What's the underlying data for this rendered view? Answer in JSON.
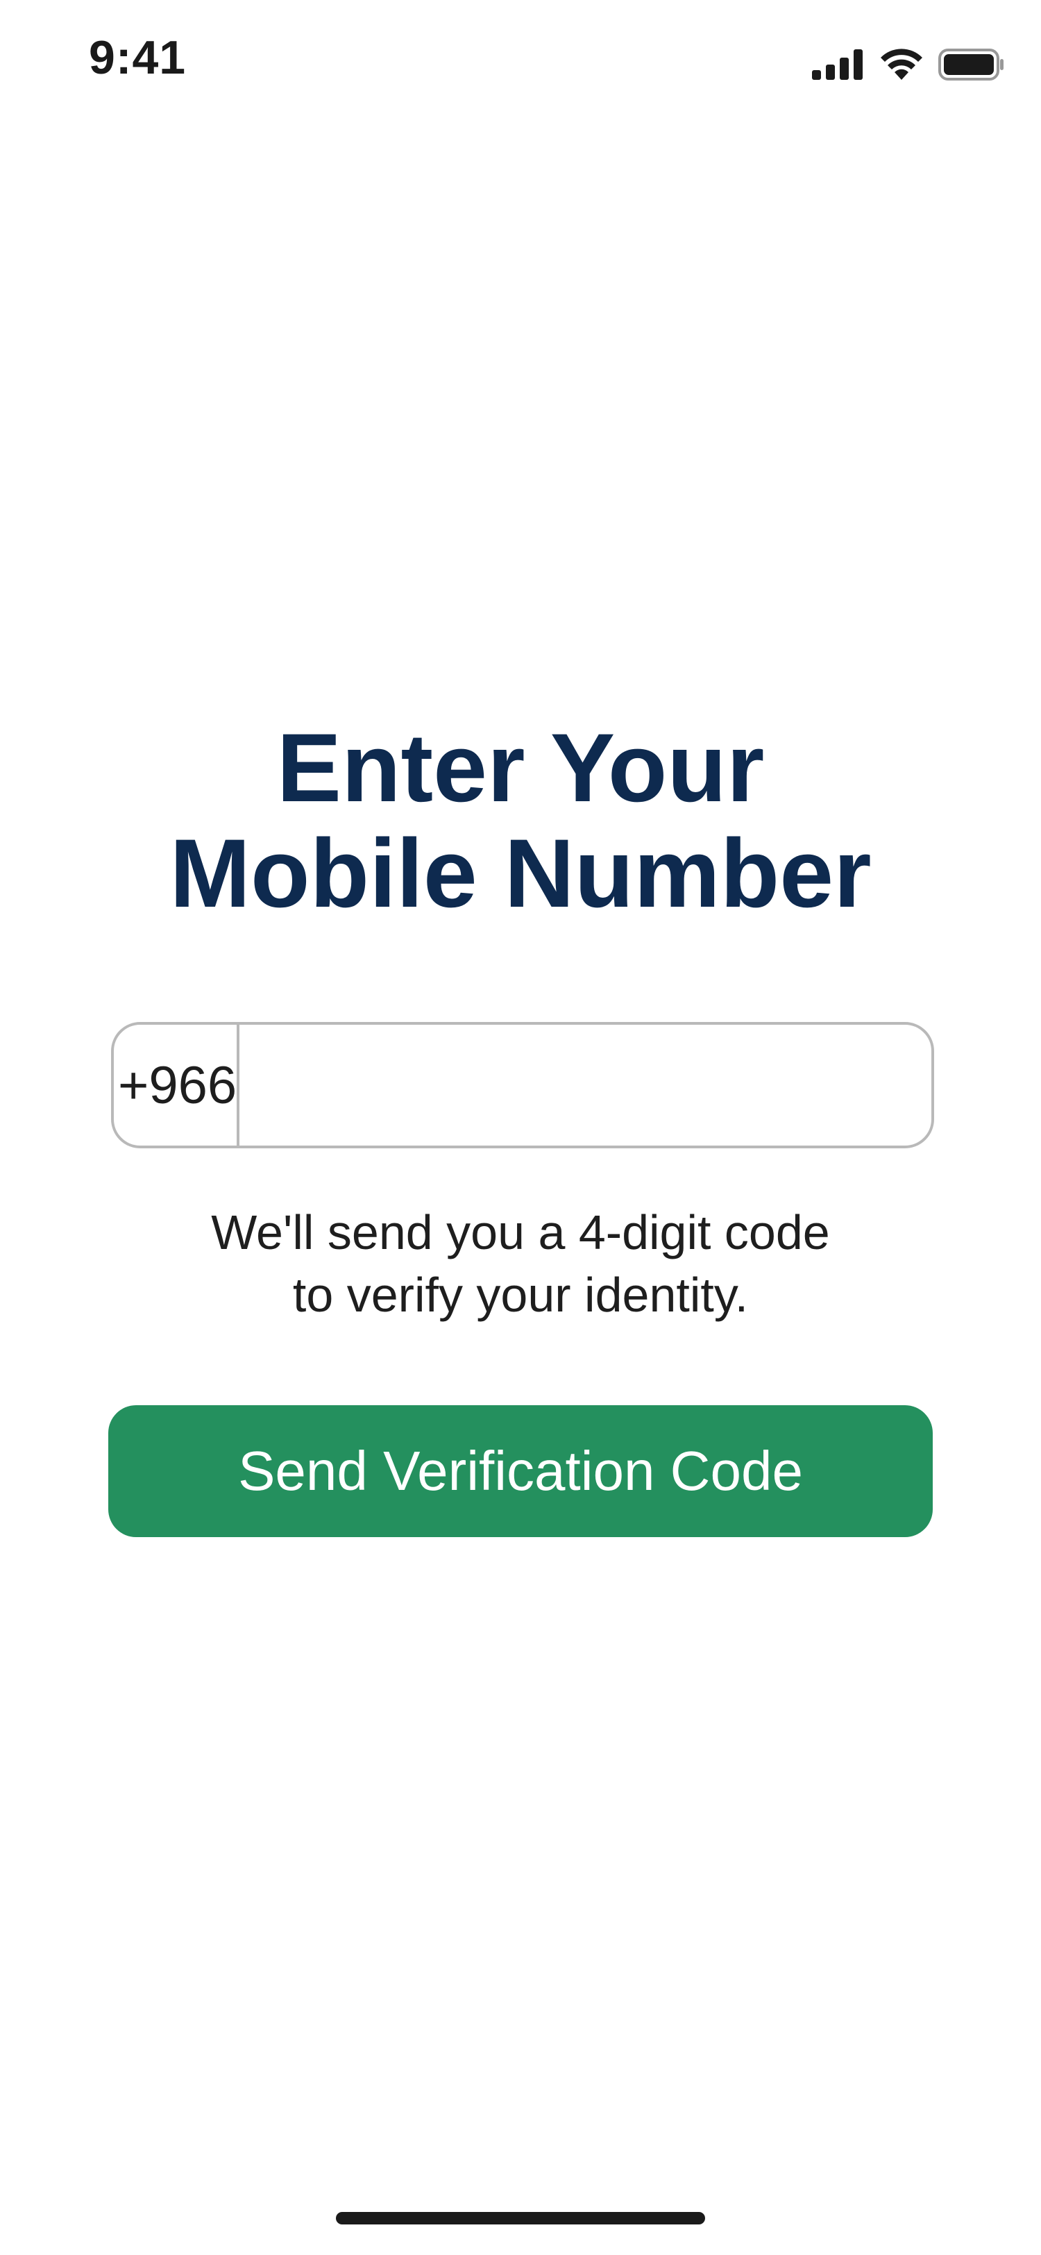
{
  "status_bar": {
    "time": "9:41",
    "icons": [
      "signal-icon",
      "wifi-icon",
      "battery-icon"
    ]
  },
  "screen": {
    "title_line_1": "Enter Your",
    "title_line_2": "Mobile Number",
    "country_code": "+966",
    "phone_value": "",
    "phone_placeholder": "",
    "helper_line_1": "We'll send you a 4-digit code",
    "helper_line_2": "to verify your identity.",
    "send_button_label": "Send Verification Code"
  },
  "colors": {
    "title": "#0e2a4f",
    "button": "#24905e",
    "button_text": "#ffffff",
    "field_border": "#b9b9b9",
    "text": "#1e1e1e"
  }
}
